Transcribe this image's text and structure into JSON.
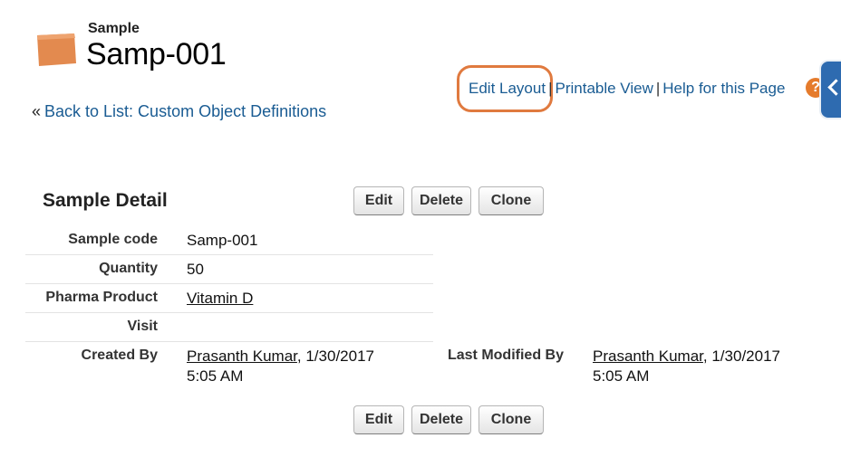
{
  "header": {
    "object_label": "Sample",
    "record_title": "Samp-001",
    "icon": "sample-object-icon",
    "icon_color": "#e38a4f"
  },
  "nav": {
    "back_prefix": "«",
    "back_link": "Back to List: Custom Object Definitions"
  },
  "top_links": {
    "edit_layout": "Edit Layout",
    "printable_view": "Printable View",
    "separator": "|",
    "help": "Help for this Page",
    "help_icon": "?",
    "highlight_color": "#e07a3f"
  },
  "detail": {
    "section_title": "Sample Detail",
    "buttons": {
      "edit": "Edit",
      "delete": "Delete",
      "clone": "Clone"
    },
    "fields": {
      "sample_code": {
        "label": "Sample code",
        "value": "Samp-001"
      },
      "quantity": {
        "label": "Quantity",
        "value": "50"
      },
      "pharma_product": {
        "label": "Pharma Product",
        "value": "Vitamin D"
      },
      "visit": {
        "label": "Visit",
        "value": ""
      },
      "created_by": {
        "label": "Created By",
        "user": "Prasanth Kumar",
        "date": ", 1/30/2017",
        "time": "5:05 AM"
      },
      "last_modified_by": {
        "label": "Last Modified By",
        "user": "Prasanth Kumar",
        "date": ", 1/30/2017",
        "time": "5:05 AM"
      }
    }
  },
  "colors": {
    "link": "#1a5c93",
    "side_tab": "#2e6bb0"
  }
}
